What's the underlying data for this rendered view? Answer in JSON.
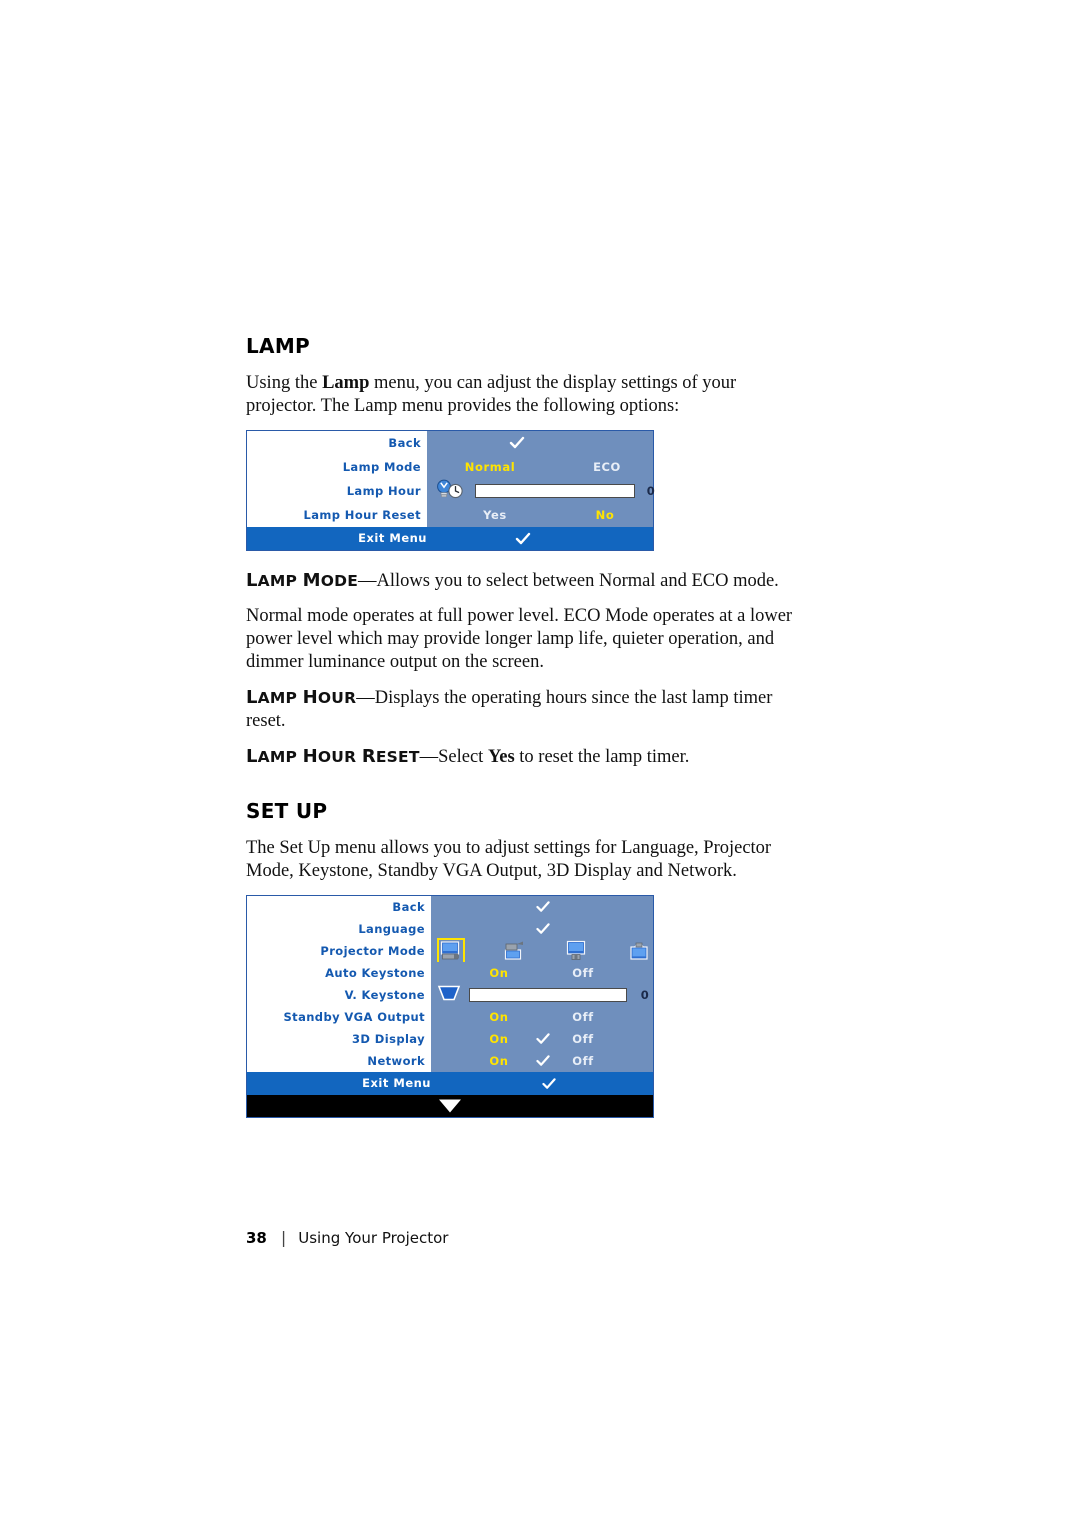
{
  "page": {
    "number": "38",
    "separator": "|",
    "footer_title": "Using Your Projector"
  },
  "lamp_section": {
    "heading": "LAMP",
    "intro": "Using the Lamp menu, you can adjust the display settings of your projector. The Lamp menu provides the following options:",
    "intro_bold_word": "Lamp",
    "terms": [
      {
        "term_first_cap": "L",
        "term_rest": "AMP ",
        "term_second_cap": "M",
        "term_second_rest": "ODE",
        "label": "LAMP MODE",
        "desc": "—Allows you to select between Normal and ECO mode."
      }
    ],
    "paragraph_normal": "Normal mode operates at full power level. ECO Mode operates at a lower power level which may provide longer lamp life, quieter operation, and dimmer luminance output on the screen.",
    "lamp_hour_label": "LAMP HOUR",
    "lamp_hour_desc": "—Displays the operating hours since the last lamp timer reset.",
    "lamp_hour_reset_label": "LAMP HOUR RESET",
    "lamp_hour_reset_desc_pre": "—Select ",
    "lamp_hour_reset_bold": "Yes",
    "lamp_hour_reset_desc_post": " to reset the lamp timer."
  },
  "lamp_menu": {
    "rows": [
      {
        "label": "Back",
        "type": "check"
      },
      {
        "label": "Lamp Mode",
        "type": "options",
        "options": [
          {
            "text": "Normal",
            "selected": true
          },
          {
            "text": "ECO",
            "selected": false
          }
        ]
      },
      {
        "label": "Lamp Hour",
        "type": "slider",
        "icon": "lamp-hour-icon",
        "value": "0",
        "fill_percent": 55
      },
      {
        "label": "Lamp Hour Reset",
        "type": "options",
        "options": [
          {
            "text": "Yes",
            "selected": false
          },
          {
            "text": "No",
            "selected": true
          }
        ]
      }
    ],
    "exit_label": "Exit Menu",
    "exit_icon": "check-icon"
  },
  "setup_section": {
    "heading": "SET UP",
    "intro": "The Set Up menu allows you to adjust settings for Language, Projector Mode, Keystone, Standby VGA Output, 3D Display and Network."
  },
  "setup_menu": {
    "rows": [
      {
        "label": "Back",
        "type": "check"
      },
      {
        "label": "Language",
        "type": "check"
      },
      {
        "label": "Projector Mode",
        "type": "icons",
        "icons": [
          {
            "name": "front-desktop-icon",
            "selected": true
          },
          {
            "name": "front-ceiling-icon",
            "selected": false
          },
          {
            "name": "rear-desktop-icon",
            "selected": false
          },
          {
            "name": "rear-ceiling-icon",
            "selected": false
          }
        ]
      },
      {
        "label": "Auto Keystone",
        "type": "options",
        "options": [
          {
            "text": "On",
            "selected": true
          },
          {
            "text": "Off",
            "selected": false
          }
        ]
      },
      {
        "label": "V. Keystone",
        "type": "slider",
        "icon": "keystone-icon",
        "value": "0",
        "fill_percent": 55
      },
      {
        "label": "Standby VGA Output",
        "type": "options",
        "options": [
          {
            "text": "On",
            "selected": true
          },
          {
            "text": "Off",
            "selected": false
          }
        ]
      },
      {
        "label": "3D Display",
        "type": "options-check",
        "options": [
          {
            "text": "On",
            "selected": true
          },
          {
            "text": "Off",
            "selected": false
          }
        ]
      },
      {
        "label": "Network",
        "type": "options-check",
        "options": [
          {
            "text": "On",
            "selected": true
          },
          {
            "text": "Off",
            "selected": false
          }
        ]
      }
    ],
    "exit_label": "Exit Menu",
    "exit_icon": "check-icon",
    "scroll_icon": "down-arrow-icon"
  },
  "colors": {
    "osd_panel_blue": "#6f8fbd",
    "osd_label_blue": "#1459b0",
    "osd_exit_blue": "#1266bf",
    "selected_yellow": "#ffe400",
    "unselected_text": "#e8eef7",
    "border_blue": "#2a5aa8"
  }
}
